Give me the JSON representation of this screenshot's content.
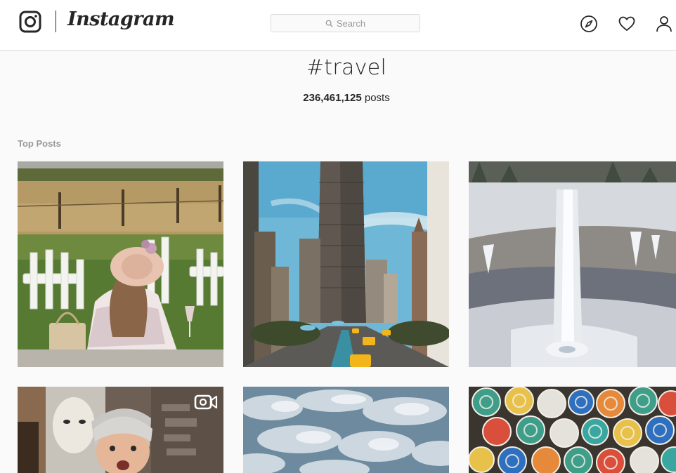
{
  "header": {
    "wordmark": "Instagram",
    "search_placeholder": "Search",
    "icons": [
      "instagram-glyph-icon",
      "search-icon",
      "compass-icon",
      "heart-icon",
      "person-icon"
    ]
  },
  "hashtag": {
    "title": "#travel",
    "post_count": "236,461,125",
    "post_count_suffix": "posts"
  },
  "sections": {
    "top_posts_label": "Top Posts"
  },
  "posts": [
    {
      "subject": "woman in hat sitting on a lawn chair by a vineyard",
      "is_video": false
    },
    {
      "subject": "Flatiron building and city street with yellow taxis",
      "is_video": false
    },
    {
      "subject": "frozen waterfall in a snowy gorge",
      "is_video": false
    },
    {
      "subject": "young man smiling in front of a cafe wall",
      "is_video": true
    },
    {
      "subject": "aerial view of clouds",
      "is_video": false
    },
    {
      "subject": "colorful ceramic plates",
      "is_video": false
    }
  ],
  "colors": {
    "background": "#fafafa",
    "header_background": "#ffffff",
    "border": "#dbdbdb",
    "text_primary": "#262626",
    "text_secondary": "#999999"
  }
}
